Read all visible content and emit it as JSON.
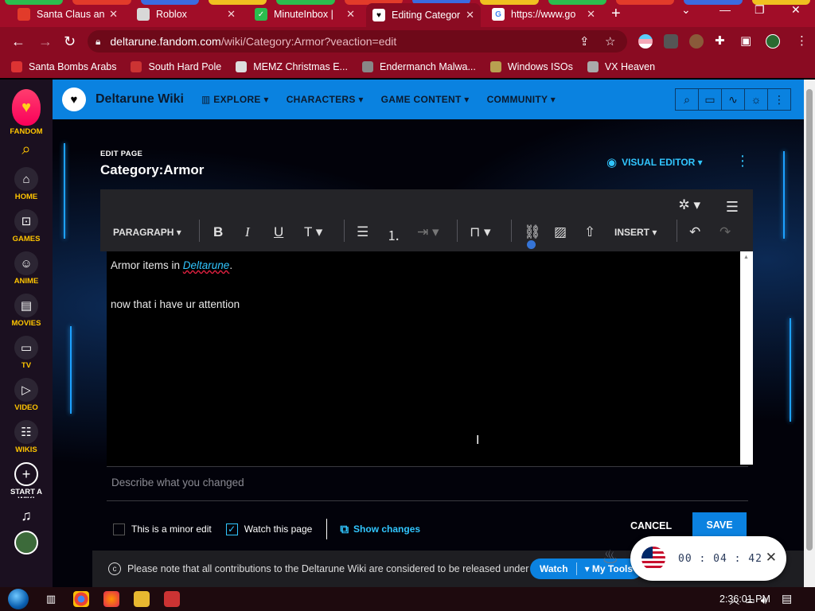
{
  "browser": {
    "tabs": [
      {
        "title": "Santa Claus an",
        "color": "#e23b2a"
      },
      {
        "title": "Roblox",
        "color": "#d8d8d8"
      },
      {
        "title": "MinuteInbox |",
        "color": "#2bbd4e"
      },
      {
        "title": "Editing Categor",
        "color": "#ffffff"
      },
      {
        "title": "https://www.go",
        "color": "#ffffff"
      }
    ],
    "url_host": "deltarune.fandom.com",
    "url_path": "/wiki/Category:Armor?veaction=edit",
    "bookmarks": [
      {
        "label": "Santa Bombs Arabs",
        "color": "#d33"
      },
      {
        "label": "South Hard Pole",
        "color": "#c33"
      },
      {
        "label": "MEMZ Christmas E...",
        "color": "#ddd"
      },
      {
        "label": "Endermanch Malwa...",
        "color": "#888"
      },
      {
        "label": "Windows ISOs",
        "color": "#b8a050"
      },
      {
        "label": "VX Heaven",
        "color": "#aaa"
      }
    ]
  },
  "rail": {
    "brand": "FANDOM",
    "items": [
      "HOME",
      "GAMES",
      "ANIME",
      "MOVIES",
      "TV",
      "VIDEO",
      "WIKIS"
    ],
    "start": "START A WIKI"
  },
  "wiki": {
    "name": "Deltarune Wiki",
    "menu": [
      "EXPLORE",
      "CHARACTERS",
      "GAME CONTENT",
      "COMMUNITY"
    ]
  },
  "editor": {
    "eyebrow": "EDIT PAGE",
    "title": "Category:Armor",
    "visual_editor": "VISUAL EDITOR",
    "paragraph": "PARAGRAPH",
    "insert": "INSERT",
    "line1_prefix": "Armor items in ",
    "line1_link": "Deltarune",
    "line1_suffix": ".",
    "line2": "now that i have ur attention",
    "summary_placeholder": "Describe what you changed",
    "minor_edit": "This is a minor edit",
    "watch_page": "Watch this page",
    "show_changes": "Show changes",
    "cancel": "CANCEL",
    "save": "SAVE"
  },
  "notice": {
    "text": "Please note that all contributions to the Deltarune Wiki are considered to be released under",
    "watch": "Watch",
    "my_tools": "My Tools"
  },
  "timer": {
    "h": "00",
    "m": "04",
    "s": "42"
  },
  "taskbar": {
    "clock": "2:36:01 PM"
  }
}
